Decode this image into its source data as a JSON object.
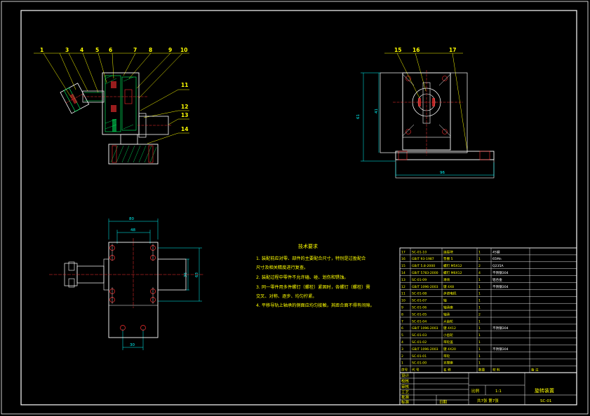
{
  "drawing": {
    "colors": {
      "background": "#000000",
      "frame": "#ffffff",
      "part": "#ffffff",
      "dimension": "#00ffff",
      "callout": "#ffff00",
      "center_line": "#ff3030",
      "hatch": "#00ff66",
      "hole": "#ff3030"
    }
  },
  "front_view": {
    "callouts": [
      "1",
      "3",
      "4",
      "5",
      "6",
      "7",
      "8",
      "9",
      "10",
      "11",
      "12",
      "13",
      "14"
    ]
  },
  "side_view": {
    "callouts": [
      "15",
      "16",
      "17"
    ],
    "dims": {
      "height_outer": "61",
      "height_inner": "41",
      "width": "96"
    }
  },
  "top_view": {
    "dims": {
      "width_outer": "80",
      "width_inner": "48",
      "height": "63",
      "height_small": "36",
      "hole_spacing": "30"
    }
  },
  "notes": {
    "title": "技术要求",
    "items": [
      "1. 装配前应对零、部件的主要配合尺寸，特别是过盈配合",
      "   尺寸及相关精度进行复查。",
      "2. 装配过程中零件不允许磕、碰、划伤和锈蚀。",
      "3. 同一零件用多件螺钉（螺栓）紧固时，各螺钉（螺栓）需",
      "   交叉、对称、逐步、均匀拧紧。",
      "4. 平移导轨上轴承的侧面应均匀接触，其距合面不得有间隙。"
    ]
  },
  "bom": {
    "header": [
      "序号",
      "代 号",
      "名 称",
      "数量",
      "材 料",
      "备 注"
    ],
    "rows": [
      [
        "17",
        "SC-01-10",
        "连接块",
        "1",
        "45钢",
        ""
      ],
      [
        "16",
        "GB/T 93-1987",
        "垫圈 5",
        "1",
        "65Mn",
        ""
      ],
      [
        "15",
        "GB/T 5.8-2000",
        "螺钉 M5X12",
        "2",
        "Q235A",
        ""
      ],
      [
        "14",
        "GB/T 5783-2000",
        "螺钉 M6X12",
        "4",
        "不锈钢304",
        ""
      ],
      [
        "13",
        "SC-01-09",
        "滑块",
        "1",
        "铝合金",
        ""
      ],
      [
        "12",
        "GB/T 1096-2003",
        "键 4X8",
        "1",
        "不锈钢304",
        ""
      ],
      [
        "11",
        "SC-01-08",
        "步进电机",
        "1",
        "",
        ""
      ],
      [
        "10",
        "SC-01-07",
        "轴",
        "1",
        "",
        ""
      ],
      [
        "9",
        "SC-01-06",
        "轴承座",
        "1",
        "",
        ""
      ],
      [
        "8",
        "SC-01-05",
        "轴承",
        "2",
        "",
        ""
      ],
      [
        "7",
        "SC-01-04",
        "大齿轮",
        "1",
        "",
        ""
      ],
      [
        "6",
        "GB/T 1096-2003",
        "键 4X12",
        "1",
        "不锈钢304",
        ""
      ],
      [
        "5",
        "SC-01-03",
        "小齿轮",
        "1",
        "",
        ""
      ],
      [
        "4",
        "SC-01-02",
        "带轮盖",
        "1",
        "",
        ""
      ],
      [
        "3",
        "GB/T 1096-2003",
        "键 4X20",
        "1",
        "不锈钢304",
        ""
      ],
      [
        "2",
        "SC-01-01",
        "带轮",
        "1",
        "",
        ""
      ],
      [
        "1",
        "SC-01-00",
        "支撑座",
        "1",
        "",
        ""
      ]
    ]
  },
  "title_block": {
    "labels": [
      "设计",
      "校核",
      "审核",
      "工艺",
      "批准",
      "标准"
    ],
    "scale_label": "比例",
    "scale_value": "1:1",
    "sheet_info": "共7张 第7张",
    "drawing_name": "旋转装置",
    "drawing_number": "SC-01",
    "date_label": "日期"
  }
}
